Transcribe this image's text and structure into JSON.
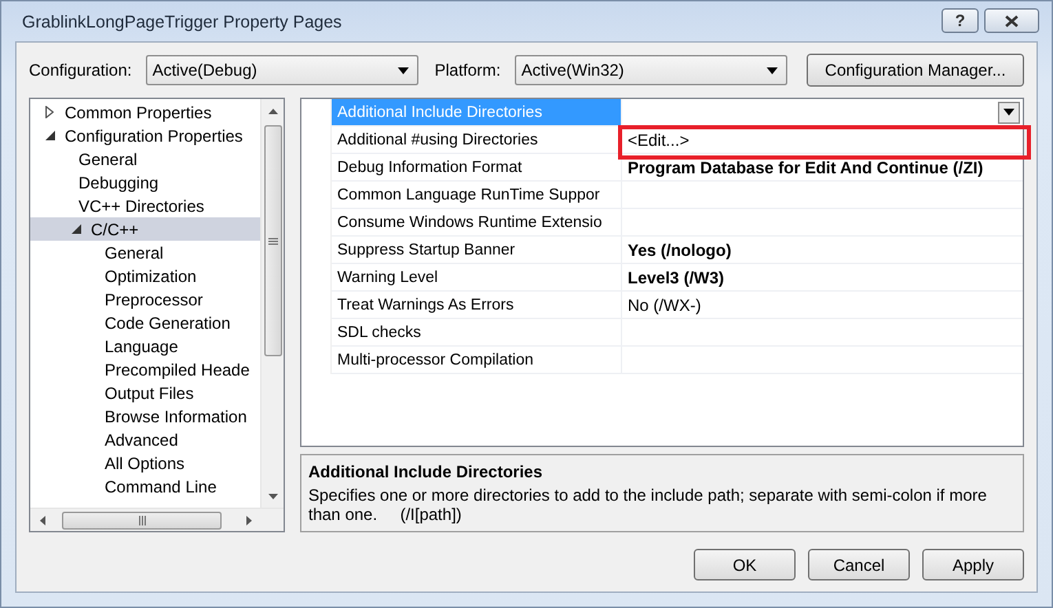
{
  "window": {
    "title": "GrablinkLongPageTrigger Property Pages",
    "help": "?"
  },
  "configuration": {
    "label": "Configuration:",
    "value": "Active(Debug)"
  },
  "platform": {
    "label": "Platform:",
    "value": "Active(Win32)"
  },
  "manager_button": "Configuration Manager...",
  "tree": [
    {
      "label": "Common Properties",
      "expanded": false,
      "selected": false
    },
    {
      "label": "Configuration Properties",
      "expanded": true,
      "selected": false,
      "children": [
        {
          "label": "General",
          "selected": false
        },
        {
          "label": "Debugging",
          "selected": false
        },
        {
          "label": "VC++ Directories",
          "selected": false
        },
        {
          "label": "C/C++",
          "expanded": true,
          "selected": true,
          "children": [
            {
              "label": "General",
              "selected": false
            },
            {
              "label": "Optimization",
              "selected": false
            },
            {
              "label": "Preprocessor",
              "selected": false
            },
            {
              "label": "Code Generation",
              "selected": false
            },
            {
              "label": "Language",
              "selected": false
            },
            {
              "label": "Precompiled Heade",
              "selected": false
            },
            {
              "label": "Output Files",
              "selected": false
            },
            {
              "label": "Browse Information",
              "selected": false
            },
            {
              "label": "Advanced",
              "selected": false
            },
            {
              "label": "All Options",
              "selected": false
            },
            {
              "label": "Command Line",
              "selected": false
            }
          ]
        }
      ]
    }
  ],
  "grid": [
    {
      "name": "Additional Include Directories",
      "modified": false,
      "selected": true,
      "highlighted": false
    },
    {
      "name": "Additional #using Directories",
      "value": "<Edit...>",
      "modified": false,
      "selected": false,
      "highlighted": true
    },
    {
      "name": "Debug Information Format",
      "value": "Program Database for Edit And Continue (/ZI)",
      "modified": true,
      "selected": false,
      "highlighted": false
    },
    {
      "name": "Common Language RunTime Suppor",
      "modified": false,
      "selected": false,
      "highlighted": false
    },
    {
      "name": "Consume Windows Runtime Extensio",
      "modified": false,
      "selected": false,
      "highlighted": false
    },
    {
      "name": "Suppress Startup Banner",
      "value": "Yes (/nologo)",
      "modified": true,
      "selected": false,
      "highlighted": false
    },
    {
      "name": "Warning Level",
      "value": "Level3 (/W3)",
      "modified": true,
      "selected": false,
      "highlighted": false
    },
    {
      "name": "Treat Warnings As Errors",
      "value": "No (/WX-)",
      "modified": false,
      "selected": false,
      "highlighted": false
    },
    {
      "name": "SDL checks",
      "modified": false,
      "selected": false,
      "highlighted": false
    },
    {
      "name": "Multi-processor Compilation",
      "modified": false,
      "selected": false,
      "highlighted": false
    }
  ],
  "description": {
    "title": "Additional Include Directories",
    "text": "Specifies one or more directories to add to the include path; separate with semi-colon if more than one.     (/I[path])"
  },
  "buttons": [
    "OK",
    "Cancel",
    "Apply"
  ]
}
